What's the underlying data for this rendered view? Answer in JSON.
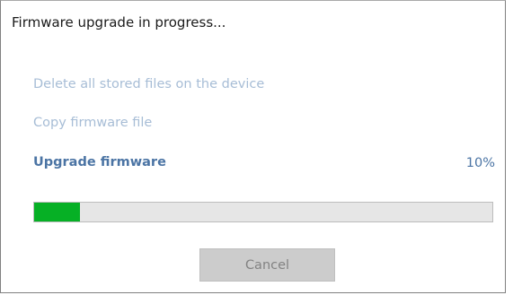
{
  "dialog": {
    "title": "Firmware upgrade in progress..."
  },
  "steps": [
    {
      "label": "Delete all stored files on the device",
      "state": "done"
    },
    {
      "label": "Copy firmware file",
      "state": "done"
    },
    {
      "label": "Upgrade firmware",
      "state": "active"
    }
  ],
  "progress": {
    "percent_label": "10%",
    "value": 0.1,
    "fill_color": "#06b025"
  },
  "colors": {
    "step_done": "#a7bdd6",
    "step_active": "#4b74a4"
  },
  "buttons": {
    "cancel_label": "Cancel",
    "cancel_enabled": false
  }
}
